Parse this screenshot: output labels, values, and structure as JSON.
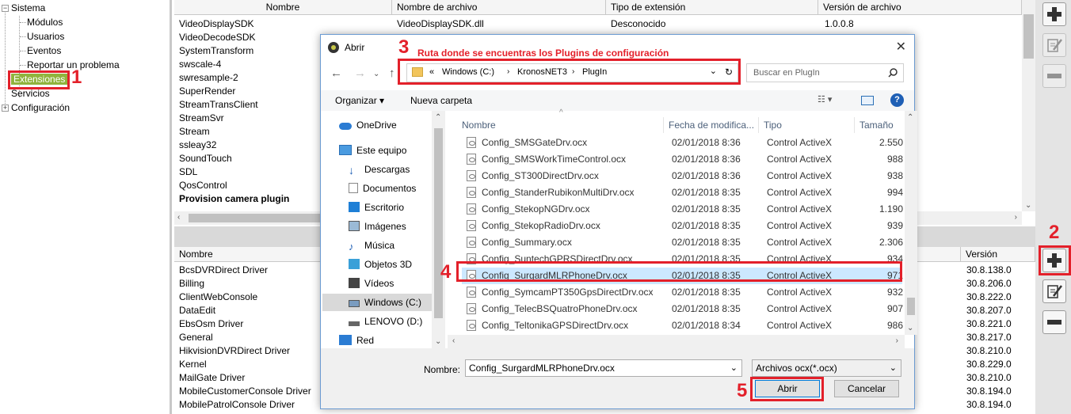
{
  "tree": {
    "root": "Sistema",
    "children": [
      "Módulos",
      "Usuarios",
      "Eventos",
      "Reportar un problema",
      "Extensiones",
      "Servicios"
    ],
    "second_root": "Configuración"
  },
  "top_grid": {
    "columns": [
      "Nombre",
      "Nombre de archivo",
      "Tipo de extensión",
      "Versión de archivo"
    ],
    "rows": [
      {
        "name": "VideoDisplaySDK",
        "file": "VideoDisplaySDK.dll",
        "type": "Desconocido",
        "version": "1.0.0.8"
      },
      {
        "name": "VideoDecodeSDK",
        "file": "",
        "type": "",
        "version": ""
      },
      {
        "name": "SystemTransform",
        "file": "",
        "type": "",
        "version": ""
      },
      {
        "name": "swscale-4",
        "file": "",
        "type": "",
        "version": ""
      },
      {
        "name": "swresample-2",
        "file": "",
        "type": "",
        "version": ""
      },
      {
        "name": "SuperRender",
        "file": "",
        "type": "",
        "version": ""
      },
      {
        "name": "StreamTransClient",
        "file": "",
        "type": "",
        "version": ""
      },
      {
        "name": "StreamSvr",
        "file": "",
        "type": "",
        "version": ""
      },
      {
        "name": "Stream",
        "file": "",
        "type": "",
        "version": ""
      },
      {
        "name": "ssleay32",
        "file": "",
        "type": "",
        "version": ""
      },
      {
        "name": "SoundTouch",
        "file": "",
        "type": "",
        "version": ""
      },
      {
        "name": "SDL",
        "file": "",
        "type": "",
        "version": ""
      },
      {
        "name": "QosControl",
        "file": "",
        "type": "",
        "version": ""
      },
      {
        "name": "Provision camera plugin",
        "file": "",
        "type": "",
        "version": ""
      }
    ]
  },
  "bottom_grid": {
    "columns": [
      "Nombre",
      "Versión"
    ],
    "rows": [
      {
        "name": "BcsDVRDirect Driver",
        "version": "30.8.138.0"
      },
      {
        "name": "Billing",
        "version": "30.8.206.0"
      },
      {
        "name": "ClientWebConsole",
        "version": "30.8.222.0"
      },
      {
        "name": "DataEdit",
        "version": "30.8.207.0"
      },
      {
        "name": "EbsOsm Driver",
        "version": "30.8.221.0"
      },
      {
        "name": "General",
        "version": "30.8.217.0"
      },
      {
        "name": "HikvisionDVRDirect Driver",
        "version": "30.8.210.0"
      },
      {
        "name": "Kernel",
        "version": "30.8.229.0"
      },
      {
        "name": "MailGate Driver",
        "version": "30.8.210.0"
      },
      {
        "name": "MobileCustomerConsole Driver",
        "version": "30.8.194.0"
      },
      {
        "name": "MobilePatrolConsole Driver",
        "version": "30.8.194.0"
      }
    ]
  },
  "annotations": {
    "n1": "1",
    "n2": "2",
    "n3": "3",
    "n4": "4",
    "n5": "5",
    "caption3": "Ruta donde se encuentras los Plugins de configuración",
    "color": "#e3202a"
  },
  "dialog": {
    "title": "Abrir",
    "path": [
      "«",
      "Windows (C:)",
      "KronosNET3",
      "PlugIn"
    ],
    "search_placeholder": "Buscar en PlugIn",
    "organize": "Organizar ▾",
    "new_folder": "Nueva carpeta",
    "nav_items": [
      {
        "label": "OneDrive",
        "icon": "cloud-icon"
      },
      {
        "label": "Este equipo",
        "icon": "computer-icon"
      },
      {
        "label": "Descargas",
        "icon": "download-icon"
      },
      {
        "label": "Documentos",
        "icon": "documents-icon"
      },
      {
        "label": "Escritorio",
        "icon": "desktop-icon"
      },
      {
        "label": "Imágenes",
        "icon": "pictures-icon"
      },
      {
        "label": "Música",
        "icon": "music-icon"
      },
      {
        "label": "Objetos 3D",
        "icon": "cube-icon"
      },
      {
        "label": "Vídeos",
        "icon": "video-icon"
      },
      {
        "label": "Windows (C:)",
        "icon": "drive-icon"
      },
      {
        "label": "LENOVO (D:)",
        "icon": "drive-icon"
      },
      {
        "label": "Red",
        "icon": "network-icon"
      }
    ],
    "file_columns": [
      "Nombre",
      "Fecha de modifica...",
      "Tipo",
      "Tamaño"
    ],
    "files": [
      {
        "name": "Config_SMSGateDrv.ocx",
        "date": "02/01/2018 8:36",
        "type": "Control ActiveX",
        "size": "2.550 k"
      },
      {
        "name": "Config_SMSWorkTimeControl.ocx",
        "date": "02/01/2018 8:36",
        "type": "Control ActiveX",
        "size": "988 k"
      },
      {
        "name": "Config_ST300DirectDrv.ocx",
        "date": "02/01/2018 8:36",
        "type": "Control ActiveX",
        "size": "938 k"
      },
      {
        "name": "Config_StanderRubikonMultiDrv.ocx",
        "date": "02/01/2018 8:35",
        "type": "Control ActiveX",
        "size": "994 k"
      },
      {
        "name": "Config_StekopNGDrv.ocx",
        "date": "02/01/2018 8:35",
        "type": "Control ActiveX",
        "size": "1.190 k"
      },
      {
        "name": "Config_StekopRadioDrv.ocx",
        "date": "02/01/2018 8:35",
        "type": "Control ActiveX",
        "size": "939 k"
      },
      {
        "name": "Config_Summary.ocx",
        "date": "02/01/2018 8:35",
        "type": "Control ActiveX",
        "size": "2.306 k"
      },
      {
        "name": "Config_SuntechGPRSDirectDrv.ocx",
        "date": "02/01/2018 8:35",
        "type": "Control ActiveX",
        "size": "934 k"
      },
      {
        "name": "Config_SurgardMLRPhoneDrv.ocx",
        "date": "02/01/2018 8:35",
        "type": "Control ActiveX",
        "size": "971"
      },
      {
        "name": "Config_SymcamPT350GpsDirectDrv.ocx",
        "date": "02/01/2018 8:35",
        "type": "Control ActiveX",
        "size": "932 k"
      },
      {
        "name": "Config_TelecBSQuatroPhoneDrv.ocx",
        "date": "02/01/2018 8:35",
        "type": "Control ActiveX",
        "size": "907 k"
      },
      {
        "name": "Config_TeltonikaGPSDirectDrv.ocx",
        "date": "02/01/2018 8:34",
        "type": "Control ActiveX",
        "size": "986 k"
      }
    ],
    "filename_label": "Nombre:",
    "filename_value": "Config_SurgardMLRPhoneDrv.ocx",
    "filter": "Archivos ocx(*.ocx)",
    "open": "Abrir",
    "cancel": "Cancelar"
  }
}
